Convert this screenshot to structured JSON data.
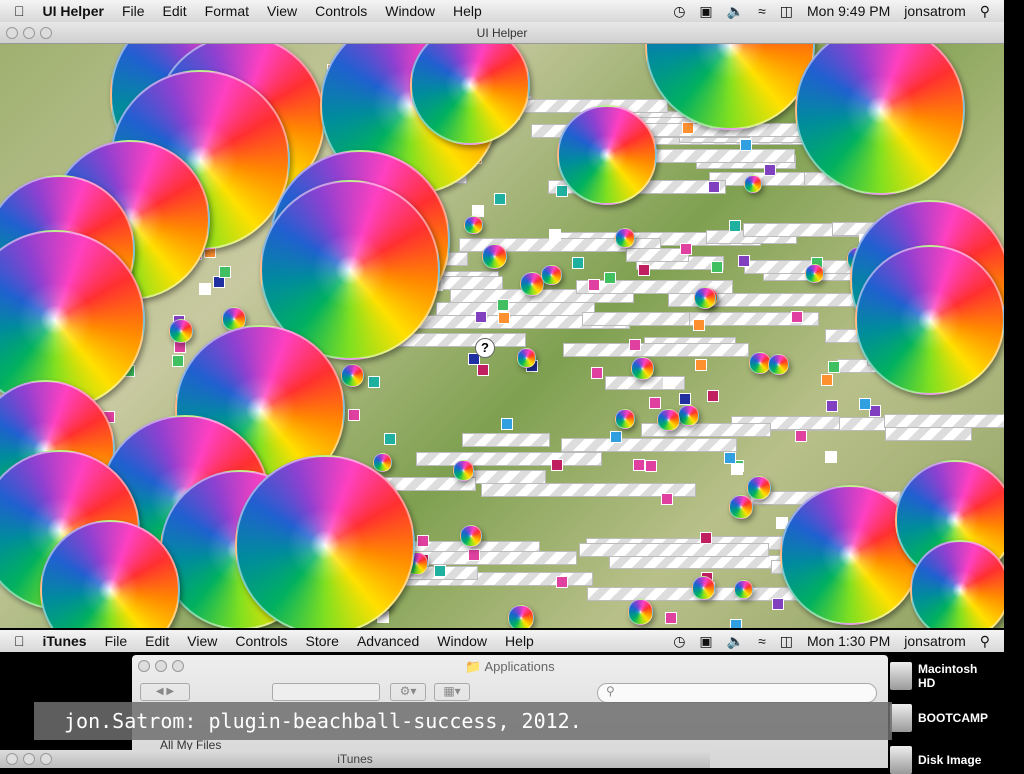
{
  "top_menubar": {
    "app": "UI Helper",
    "items": [
      "File",
      "Edit",
      "Format",
      "View",
      "Controls",
      "Window",
      "Help"
    ],
    "clock": "Mon 9:49 PM",
    "user": "jonsatrom"
  },
  "window": {
    "title": "UI Helper"
  },
  "canvas_dialog": {
    "question_mark": "?"
  },
  "bottom_menubar": {
    "app": "iTunes",
    "items": [
      "File",
      "Edit",
      "View",
      "Controls",
      "Store",
      "Advanced",
      "Window",
      "Help"
    ],
    "clock": "Mon 1:30 PM",
    "user": "jonsatrom"
  },
  "finder": {
    "title": "Applications",
    "sidebar_item": "All My Files"
  },
  "itunes_window": {
    "title": "iTunes"
  },
  "desktop_icons": [
    "Macintosh HD",
    "BOOTCAMP",
    "Disk Image"
  ],
  "caption": "jon.Satrom: plugin-beachball-success, 2012."
}
